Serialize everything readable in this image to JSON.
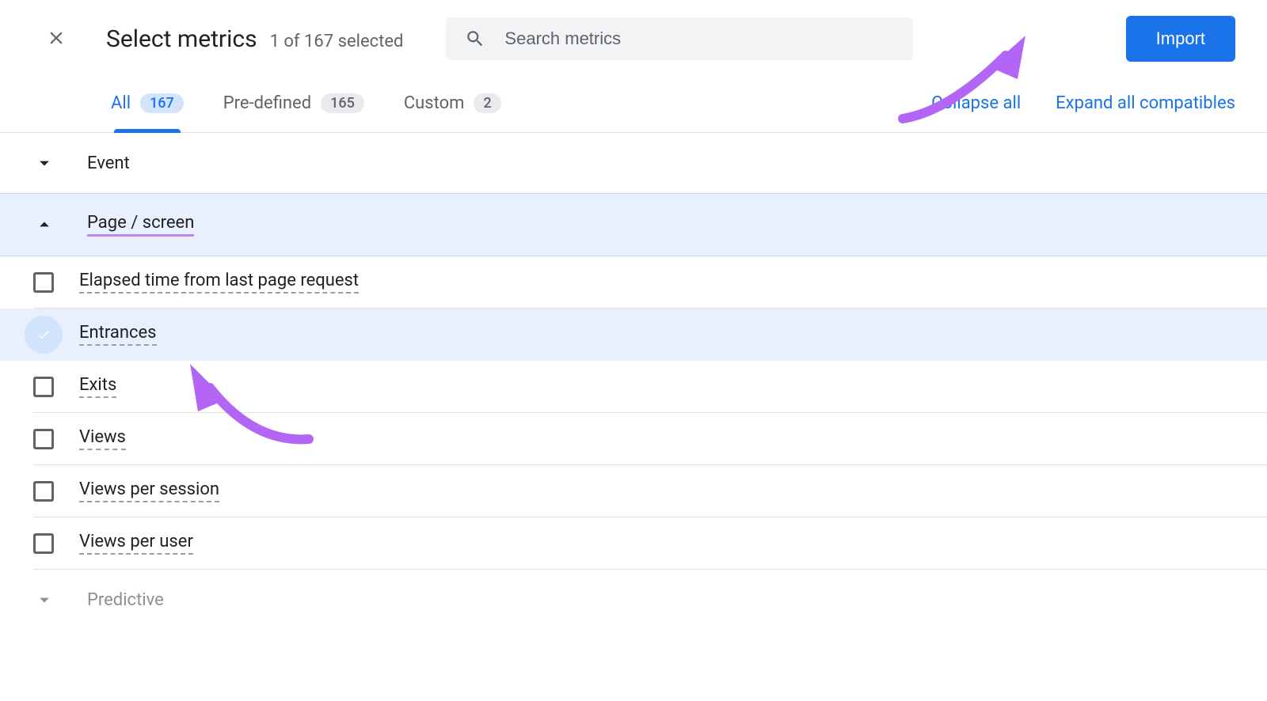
{
  "header": {
    "title": "Select metrics",
    "subtitle": "1 of 167 selected",
    "search_placeholder": "Search metrics",
    "import_label": "Import"
  },
  "tabs": [
    {
      "label": "All",
      "count": "167",
      "active": true
    },
    {
      "label": "Pre-defined",
      "count": "165",
      "active": false
    },
    {
      "label": "Custom",
      "count": "2",
      "active": false
    }
  ],
  "links": {
    "collapse": "Collapse all",
    "expand": "Expand all compatibles"
  },
  "sections": {
    "event": {
      "title": "Event"
    },
    "page_screen": {
      "title": "Page / screen"
    },
    "predictive": {
      "title": "Predictive"
    }
  },
  "metrics": [
    {
      "name": "Elapsed time from last page request",
      "checked": false
    },
    {
      "name": "Entrances",
      "checked": true
    },
    {
      "name": "Exits",
      "checked": false
    },
    {
      "name": "Views",
      "checked": false
    },
    {
      "name": "Views per session",
      "checked": false
    },
    {
      "name": "Views per user",
      "checked": false
    }
  ]
}
